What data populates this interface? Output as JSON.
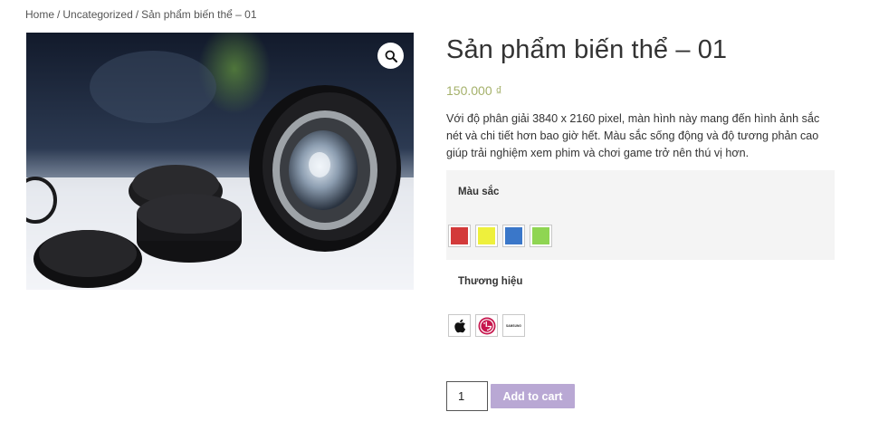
{
  "breadcrumb": {
    "items": [
      "Home",
      "Uncategorized",
      "Sản phẩm biến thể – 01"
    ],
    "separator": "/"
  },
  "gallery": {
    "zoom_icon": "magnifier-icon"
  },
  "product": {
    "title": "Sản phẩm biến thể – 01",
    "price": "150.000 ₫",
    "description": "Với độ phân giải 3840 x 2160 pixel, màn hình này mang đến hình ảnh sắc nét và chi tiết hơn bao giờ hết. Màu sắc sống động và độ tương phản cao giúp trải nghiệm xem phim và chơi game trở nên thú vị hơn."
  },
  "attributes": {
    "color_label": "Màu sắc",
    "colors": [
      "#d33a3a",
      "#eef03c",
      "#3a77c9",
      "#8fd552"
    ],
    "brand_label": "Thương hiệu",
    "brands": [
      "apple-logo-icon",
      "lg-logo-icon",
      "SAMSUNG"
    ]
  },
  "cart": {
    "quantity": "1",
    "add_label": "Add to cart"
  },
  "colors": {
    "price": "#a5b16b",
    "button": "#b9a8d4",
    "attr_bg": "#f4f4f4"
  }
}
